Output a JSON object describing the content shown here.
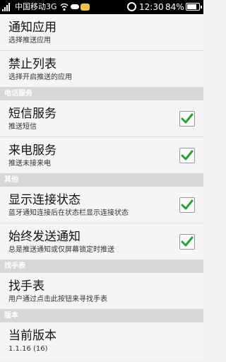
{
  "status_bar": {
    "carrier": "中国移动3G",
    "time": "12:30",
    "battery": "84%",
    "battery_level": 0.84
  },
  "sections": [
    {
      "header": null,
      "items": [
        {
          "title": "通知应用",
          "summary": "选择推送应用",
          "checkbox": null
        },
        {
          "title": "禁止列表",
          "summary": "选择开启推送的应用",
          "checkbox": null
        }
      ]
    },
    {
      "header": "电话服务",
      "items": [
        {
          "title": "短信服务",
          "summary": "推送短信",
          "checkbox": true
        },
        {
          "title": "来电服务",
          "summary": "推送未接来电",
          "checkbox": true
        }
      ]
    },
    {
      "header": "其他",
      "items": [
        {
          "title": "显示连接状态",
          "summary": "蓝牙通知连接后在状态栏显示连接状态",
          "checkbox": true
        },
        {
          "title": "始终发送通知",
          "summary": "总是推送通知或仅屏幕锁定时推送",
          "checkbox": true
        }
      ]
    },
    {
      "header": "找手表",
      "items": [
        {
          "title": "找手表",
          "summary": "用户通过点击此按钮来寻找手表",
          "checkbox": null
        }
      ]
    },
    {
      "header": "版本",
      "items": [
        {
          "title": "当前版本",
          "summary": "1.1.16 (16)",
          "checkbox": null
        }
      ]
    }
  ],
  "colors": {
    "check": "#2e9e3a",
    "header_bg": "#d7d7d7"
  }
}
